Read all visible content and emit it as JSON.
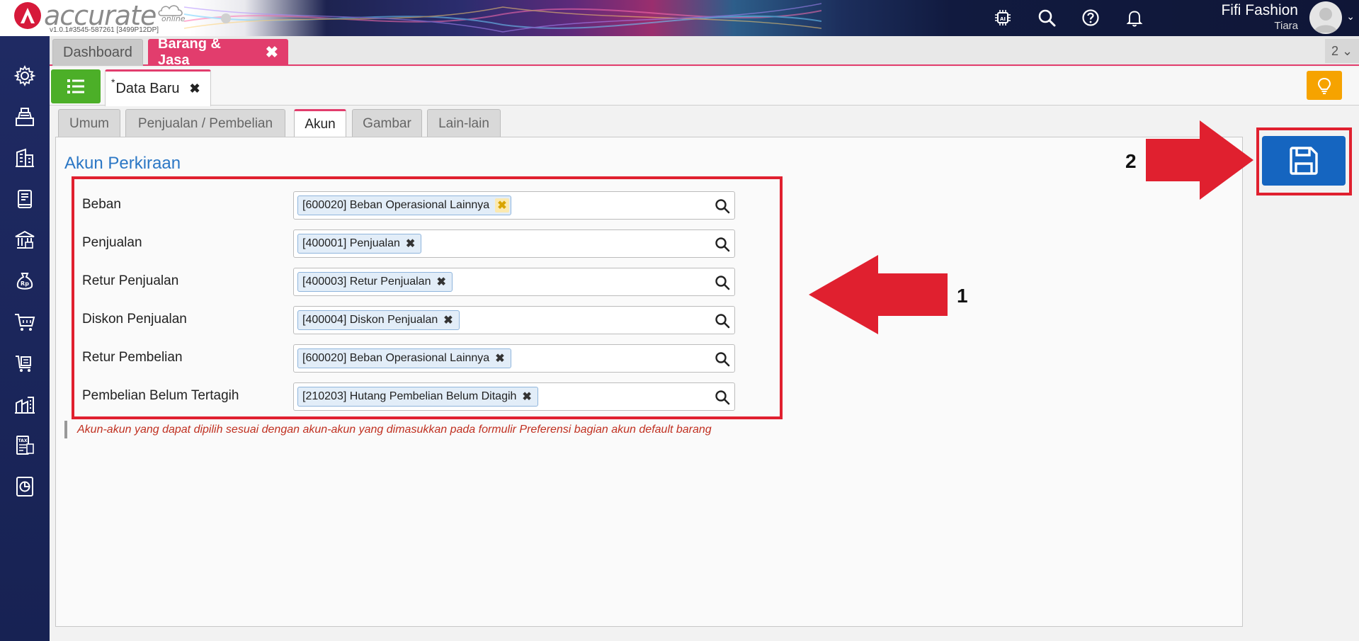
{
  "brand": {
    "name": "accurate",
    "sub": "online",
    "version": "v1.0.1#3545-587261 [3499P12DP]"
  },
  "user": {
    "name": "Fifi Fashion",
    "sub": "Tiara"
  },
  "top_icons": [
    "ai-chip-icon",
    "search-icon",
    "help-icon",
    "bell-icon"
  ],
  "tabs": {
    "dashboard": "Dashboard",
    "active": "Barang & Jasa",
    "close": "✖",
    "counter": "2 ⌄"
  },
  "doc_tab": {
    "star": "*",
    "label": "Data Baru",
    "close": "✖"
  },
  "form_tabs": [
    "Umum",
    "Penjualan / Pembelian",
    "Akun",
    "Gambar",
    "Lain-lain"
  ],
  "active_form_tab": "Akun",
  "section_title": "Akun Perkiraan",
  "fields": [
    {
      "label": "Beban",
      "value": "[600020] Beban Operasional Lainnya",
      "remove": "✖"
    },
    {
      "label": "Penjualan",
      "value": "[400001] Penjualan",
      "remove": "✖"
    },
    {
      "label": "Retur Penjualan",
      "value": "[400003] Retur Penjualan",
      "remove": "✖"
    },
    {
      "label": "Diskon Penjualan",
      "value": "[400004] Diskon Penjualan",
      "remove": "✖"
    },
    {
      "label": "Retur Pembelian",
      "value": "[600020] Beban Operasional Lainnya",
      "remove": "✖"
    },
    {
      "label": "Pembelian Belum Tertagih",
      "value": "[210203] Hutang Pembelian Belum Ditagih",
      "remove": "✖"
    }
  ],
  "note": "Akun-akun yang dapat dipilih sesuai dengan akun-akun yang dimasukkan pada formulir Preferensi bagian akun default barang",
  "annotations": {
    "one": "1",
    "two": "2"
  },
  "colors": {
    "accent": "#e23d6d",
    "sidebar": "#1f2a63",
    "save": "#1565c0",
    "list_btn": "#4caf28",
    "bulb": "#f6a300",
    "annotation_red": "#e0202f",
    "title_blue": "#2b77c5"
  }
}
